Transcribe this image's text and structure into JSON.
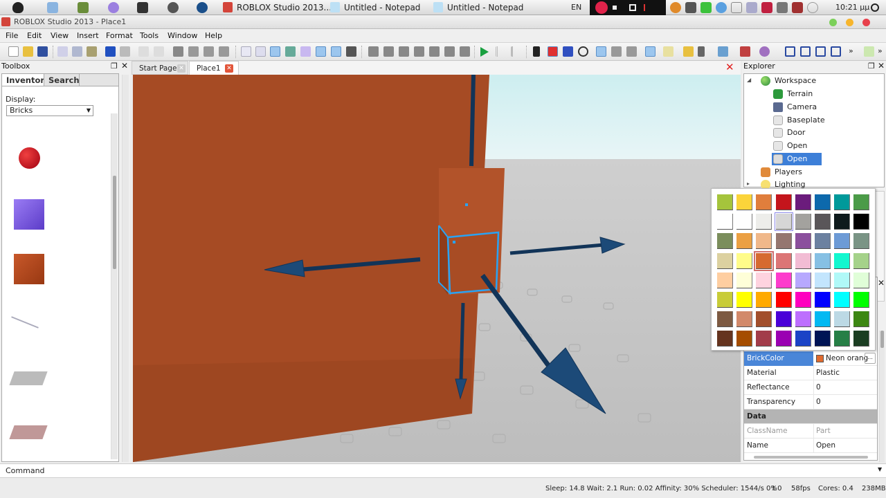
{
  "os_taskbar": {
    "tasks": [
      {
        "label": "ROBLOX Studio 2013..."
      },
      {
        "label": "Untitled - Notepad"
      },
      {
        "label": "Untitled - Notepad"
      }
    ],
    "language": "EN",
    "clock": "10:21 μμ"
  },
  "window": {
    "title": "ROBLOX Studio 2013 - Place1"
  },
  "menu": [
    "File",
    "Edit",
    "View",
    "Insert",
    "Format",
    "Tools",
    "Window",
    "Help"
  ],
  "toolbox": {
    "title": "Toolbox",
    "tabs": [
      "Inventory",
      "Search"
    ],
    "display_label": "Display:",
    "display_value": "Bricks",
    "items": [
      "red-sphere",
      "purple-block",
      "orange-block",
      "wedge",
      "grey-plate",
      "pink-plate"
    ]
  },
  "doc_tabs": [
    {
      "label": "Start Page",
      "active": false
    },
    {
      "label": "Place1",
      "active": true
    }
  ],
  "explorer": {
    "title": "Explorer",
    "items": [
      {
        "label": "Workspace",
        "level": 0,
        "icon": "globe-icon"
      },
      {
        "label": "Terrain",
        "level": 1,
        "icon": "terrain-icon"
      },
      {
        "label": "Camera",
        "level": 1,
        "icon": "camera-icon"
      },
      {
        "label": "Baseplate",
        "level": 1,
        "icon": "part-icon"
      },
      {
        "label": "Door",
        "level": 1,
        "icon": "part-icon"
      },
      {
        "label": "Open",
        "level": 1,
        "icon": "part-icon"
      },
      {
        "label": "Open",
        "level": 1,
        "icon": "part-icon",
        "selected": true
      },
      {
        "label": "Players",
        "level": 0,
        "icon": "players-icon"
      },
      {
        "label": "Lighting",
        "level": 0,
        "icon": "lighting-icon"
      }
    ]
  },
  "properties": {
    "rows": [
      {
        "key": "BrickColor",
        "value": "Neon orang",
        "highlight": true,
        "swatch": "#e06a2e"
      },
      {
        "key": "Material",
        "value": "Plastic"
      },
      {
        "key": "Reflectance",
        "value": "0"
      },
      {
        "key": "Transparency",
        "value": "0"
      },
      {
        "key": "Data",
        "section": true
      },
      {
        "key": "ClassName",
        "value": "Part",
        "readonly": true
      },
      {
        "key": "Name",
        "value": "Open"
      }
    ]
  },
  "palette": {
    "colors": [
      [
        "#a5c43c",
        "#fbd43a",
        "#e07e3c",
        "#c4151c",
        "#6b1c7c",
        "#0d69ac",
        "#00999a",
        "#4b9b48"
      ],
      [
        "#ffffff",
        "#fefefe",
        "#ededea",
        "#d6d6d6",
        "#a3a29e",
        "#5a5659",
        "#0e1a1c",
        "#000000"
      ],
      [
        "#7b8e5c",
        "#eba043",
        "#f0b88a",
        "#957670",
        "#8b4f9d",
        "#6c81a0",
        "#6d9bd6",
        "#7a9485"
      ],
      [
        "#dcd1a0",
        "#fffc8a",
        "#d66a30",
        "#dc7576",
        "#f2bcd4",
        "#86c0e4",
        "#13f7cf",
        "#a5d28a"
      ],
      [
        "#fecea1",
        "#fefed8",
        "#fed3df",
        "#fd3ccc",
        "#b7a8fe",
        "#c3e5fd",
        "#b0f9f8",
        "#e0fed8"
      ],
      [
        "#c8cc38",
        "#ffff00",
        "#ffaa00",
        "#ff0000",
        "#ff00bf",
        "#0000ff",
        "#00ffff",
        "#00ff00"
      ],
      [
        "#7d5a42",
        "#d2896a",
        "#a24f2c",
        "#4a00d8",
        "#bd6ffe",
        "#02b9f2",
        "#bcd9e5",
        "#3c8713"
      ],
      [
        "#65341f",
        "#a54d00",
        "#a23c4a",
        "#9a00b2",
        "#1b43c6",
        "#001455",
        "#267f46",
        "#1b3e22"
      ]
    ],
    "selected": [
      3,
      2
    ],
    "hovered": [
      1,
      3
    ]
  },
  "command": {
    "label": "Command >",
    "value": ""
  },
  "status": {
    "text": "Sleep: 14.8 Wait: 2.1 Run: 0.02 Affinity: 30% Scheduler: 1544/s 0%",
    "t": "t 0",
    "fps": "58fps",
    "cores": "Cores: 0.4",
    "memory": "238MB"
  }
}
